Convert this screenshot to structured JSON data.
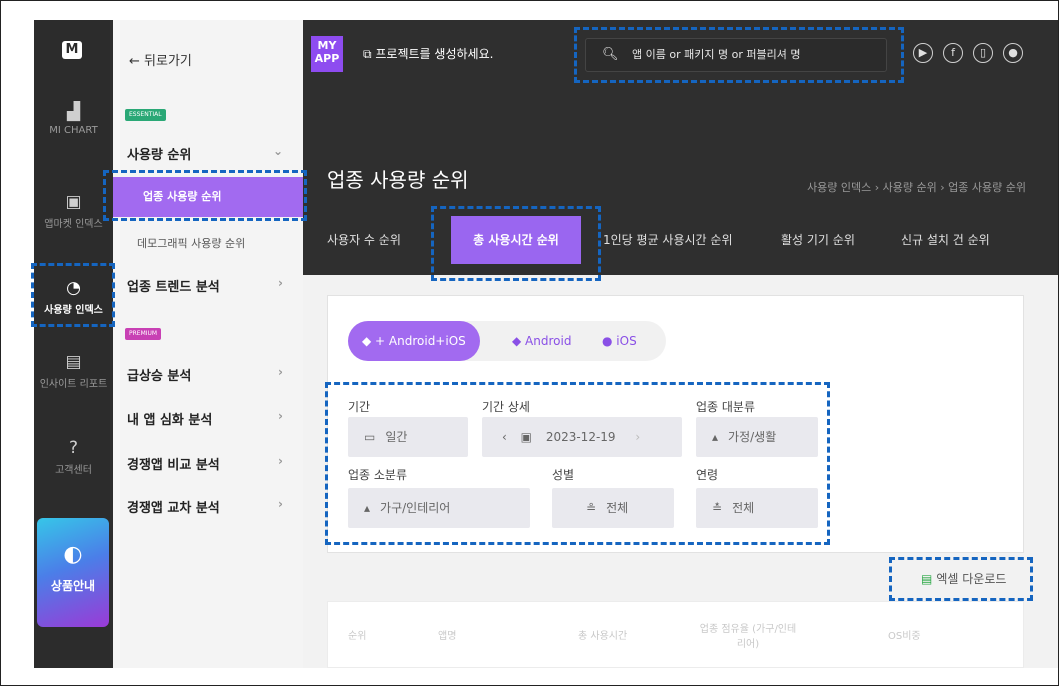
{
  "rail": {
    "logo": "M",
    "items": [
      {
        "label": "MI CHART",
        "icon": "bar-chart-icon"
      },
      {
        "label": "앱마켓 인덱스",
        "icon": "shopping-bag-icon"
      },
      {
        "label": "사용량 인덱스",
        "icon": "gauge-icon"
      },
      {
        "label": "인사이트 리포트",
        "icon": "report-icon"
      },
      {
        "label": "고객센터",
        "icon": "question-icon"
      }
    ],
    "promo_label": "상품안내"
  },
  "menu": {
    "back": "← 뒤로가기",
    "badge_essential": "ESSENTIAL",
    "badge_premium": "PREMIUM",
    "usage_rank": "사용량 순위",
    "active_item": "업종 사용량 순위",
    "demographic": "데모그래픽 사용량 순위",
    "trend": "업종 트렌드 분석",
    "surge": "급상승 분석",
    "deep": "내 앱 심화 분석",
    "compare": "경쟁앱 비교 분석",
    "cross": "경쟁앱 교차 분석"
  },
  "topbar": {
    "myapp": "MY APP",
    "create_project": "프로젝트를 생성하세요.",
    "search_placeholder": "앱 이름 or 패키지 명 or 퍼블리셔 명"
  },
  "header": {
    "title": "업종 사용량 순위",
    "breadcrumb": "사용량 인덱스 › 사용량 순위 › 업종 사용량 순위",
    "tabs": [
      "사용자 수 순위",
      "총 사용시간 순위",
      "1인당 평균 사용시간 순위",
      "활성 기기 순위",
      "신규 설치 건 순위"
    ]
  },
  "filters": {
    "os": [
      "+ Android+iOS",
      "Android",
      "iOS"
    ],
    "period_label": "기간",
    "period_value": "일간",
    "period_detail_label": "기간 상세",
    "date_value": "2023-12-19",
    "category_major_label": "업종 대분류",
    "category_major_value": "가정/생활",
    "category_minor_label": "업종 소분류",
    "category_minor_value": "가구/인테리어",
    "gender_label": "성별",
    "gender_value": "전체",
    "age_label": "연령",
    "age_value": "전체"
  },
  "excel_download": "엑셀 다운로드",
  "table": {
    "headers": [
      "순위",
      "앱명",
      "총 사용시간",
      "업종 점유율 (가구/인테리어)",
      "OS비중"
    ]
  }
}
